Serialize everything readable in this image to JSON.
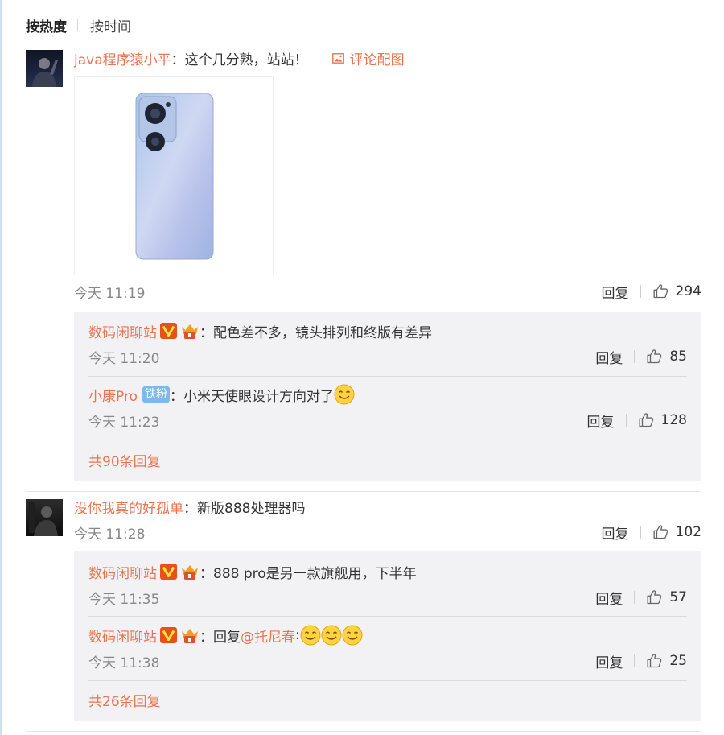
{
  "sort": {
    "active": "按热度",
    "inactive": "按时间"
  },
  "comments": [
    {
      "user": "java程序猿小平",
      "text": "：这个几分熟，站站！",
      "pic_link": "评论配图",
      "time": "今天 11:19",
      "reply_label": "回复",
      "likes": "294",
      "replies": [
        {
          "user": "数码闲聊站",
          "text": "：配色差不多，镜头排列和终版有差异",
          "time": "今天 11:20",
          "reply_label": "回复",
          "likes": "85"
        },
        {
          "user": "小康Pro",
          "badge": "铁粉",
          "text": "：小米天使眼设计方向对了",
          "time": "今天 11:23",
          "reply_label": "回复",
          "likes": "128"
        }
      ],
      "more": "共90条回复"
    },
    {
      "user": "没你我真的好孤单",
      "text": "：新版888处理器吗",
      "time": "今天 11:28",
      "reply_label": "回复",
      "likes": "102",
      "replies": [
        {
          "user": "数码闲聊站",
          "text": "：888 pro是另一款旗舰用，下半年",
          "time": "今天 11:35",
          "reply_label": "回复",
          "likes": "57"
        },
        {
          "user": "数码闲聊站",
          "text_prefix": "：回复",
          "mention": "@托尼春",
          "text_suffix": ":",
          "time": "今天 11:38",
          "reply_label": "回复",
          "likes": "25"
        }
      ],
      "more": "共26条回复"
    }
  ],
  "colors": {
    "link": "#eb7350",
    "meta": "#888888",
    "reply_bg": "#f2f2f5",
    "verified": "#e8501b",
    "fan_badge": "#7fb8eb"
  },
  "icons": {
    "picture": "picture-icon",
    "like": "thumbs-up-icon",
    "verified": "verified-v-icon",
    "fan": "fan-crown-icon",
    "emoji": "smile-emoji-icon"
  }
}
